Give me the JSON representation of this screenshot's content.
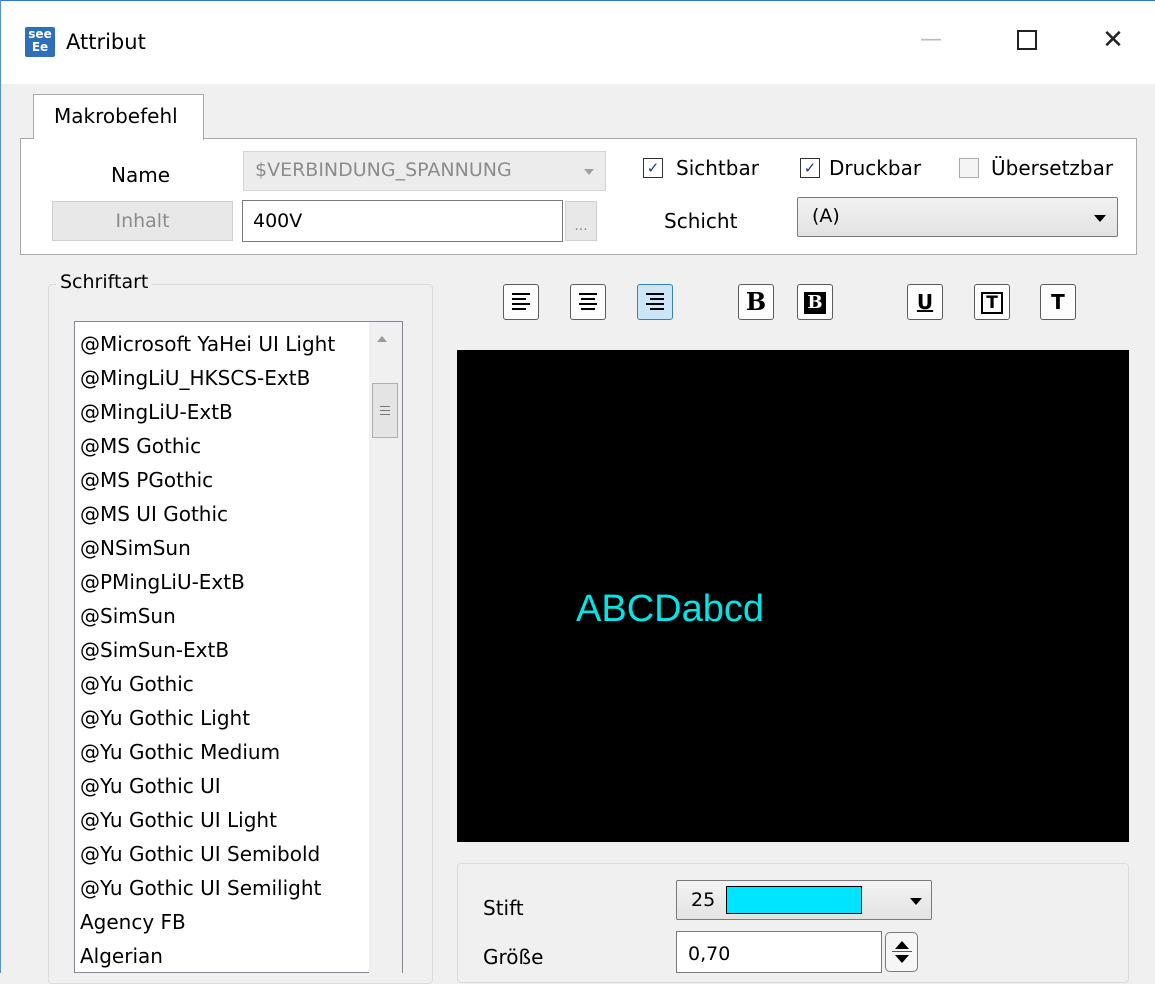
{
  "window": {
    "title": "Attribut",
    "app_icon_top": "see",
    "app_icon_bottom": "Ee",
    "minimize_glyph": "—",
    "close_glyph": "✕"
  },
  "tab": {
    "label": "Makrobefehl"
  },
  "macro": {
    "name_label": "Name",
    "name_value": "$VERBINDUNG_SPANNUNG",
    "content_button": "Inhalt",
    "content_value": "400V",
    "ellipsis": "...",
    "layer_label": "Schicht",
    "layer_value": "(A)"
  },
  "checkboxes": [
    {
      "label": "Sichtbar",
      "checked": true
    },
    {
      "label": "Druckbar",
      "checked": true
    },
    {
      "label": "Übersetzbar",
      "checked": false
    }
  ],
  "font_group": {
    "legend": "Schriftart",
    "fonts": [
      "@Microsoft YaHei UI Light",
      "@MingLiU_HKSCS-ExtB",
      "@MingLiU-ExtB",
      "@MS Gothic",
      "@MS PGothic",
      "@MS UI Gothic",
      "@NSimSun",
      "@PMingLiU-ExtB",
      "@SimSun",
      "@SimSun-ExtB",
      "@Yu Gothic",
      "@Yu Gothic Light",
      "@Yu Gothic Medium",
      "@Yu Gothic UI",
      "@Yu Gothic UI Light",
      "@Yu Gothic UI Semibold",
      "@Yu Gothic UI Semilight",
      "Agency FB",
      "Algerian"
    ]
  },
  "format_buttons": {
    "bold_label": "B",
    "bold_inverse_label": "B",
    "underline_label": "U",
    "framed_label": "T",
    "plain_label": "T"
  },
  "preview": {
    "text": "ABCDabcd",
    "text_color": "#00e5e5",
    "background": "#000000"
  },
  "pen": {
    "label": "Stift",
    "value": "25",
    "color": "#00e5ff"
  },
  "size": {
    "label": "Größe",
    "value": "0,70"
  }
}
